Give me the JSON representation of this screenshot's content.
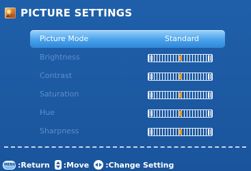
{
  "title": "PICTURE SETTINGS",
  "title_icon": "picture-settings-icon",
  "menu": {
    "items": [
      {
        "label": "Picture Mode",
        "value": "Standard",
        "selected": true
      },
      {
        "label": "Brightness",
        "level": 0.5
      },
      {
        "label": "Contrast",
        "level": 0.5
      },
      {
        "label": "Saturation",
        "level": 0.5
      },
      {
        "label": "Hue",
        "level": 0.5
      },
      {
        "label": "Sharpness",
        "level": 0.5
      }
    ]
  },
  "footer": {
    "return_label": ":Return",
    "move_label": ":Move",
    "change_label": ":Change Setting",
    "icons": [
      "menu-key-icon",
      "up-down-key-icon",
      "left-right-key-icon"
    ]
  },
  "colors": {
    "background": "#1d5ba4",
    "highlight": "#4ea5ec",
    "inactive_label": "#5f8ecb",
    "slider_thumb": "#e89a2c"
  }
}
